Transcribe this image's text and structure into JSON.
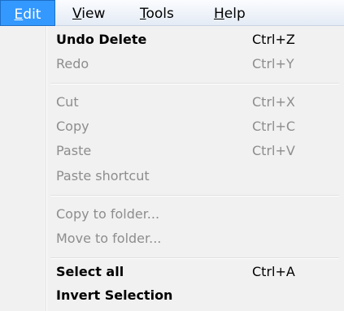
{
  "menubar": {
    "items": [
      {
        "label": "Edit",
        "mnemonic": "E",
        "rest": "dit",
        "state": "active"
      },
      {
        "label": "View",
        "mnemonic": "V",
        "rest": "iew",
        "state": "normal"
      },
      {
        "label": "Tools",
        "mnemonic": "T",
        "rest": "ools",
        "state": "normal"
      },
      {
        "label": "Help",
        "mnemonic": "H",
        "rest": "elp",
        "state": "normal"
      }
    ]
  },
  "edit_menu": {
    "items": [
      {
        "label": "Undo Delete",
        "shortcut": "Ctrl+Z",
        "enabled": true
      },
      {
        "label": "Redo",
        "shortcut": "Ctrl+Y",
        "enabled": false
      },
      {
        "label": "Cut",
        "shortcut": "Ctrl+X",
        "enabled": false
      },
      {
        "label": "Copy",
        "shortcut": "Ctrl+C",
        "enabled": false
      },
      {
        "label": "Paste",
        "shortcut": "Ctrl+V",
        "enabled": false
      },
      {
        "label": "Paste shortcut",
        "shortcut": "",
        "enabled": false
      },
      {
        "label": "Copy to folder...",
        "shortcut": "",
        "enabled": false
      },
      {
        "label": "Move to folder...",
        "shortcut": "",
        "enabled": false
      },
      {
        "label": "Select all",
        "shortcut": "Ctrl+A",
        "enabled": true
      },
      {
        "label": "Invert Selection",
        "shortcut": "",
        "enabled": true
      }
    ]
  },
  "colors": {
    "menubar_highlight": "#3399ff",
    "menu_background": "#f1f1f1",
    "disabled_text": "#8d8d8d"
  }
}
